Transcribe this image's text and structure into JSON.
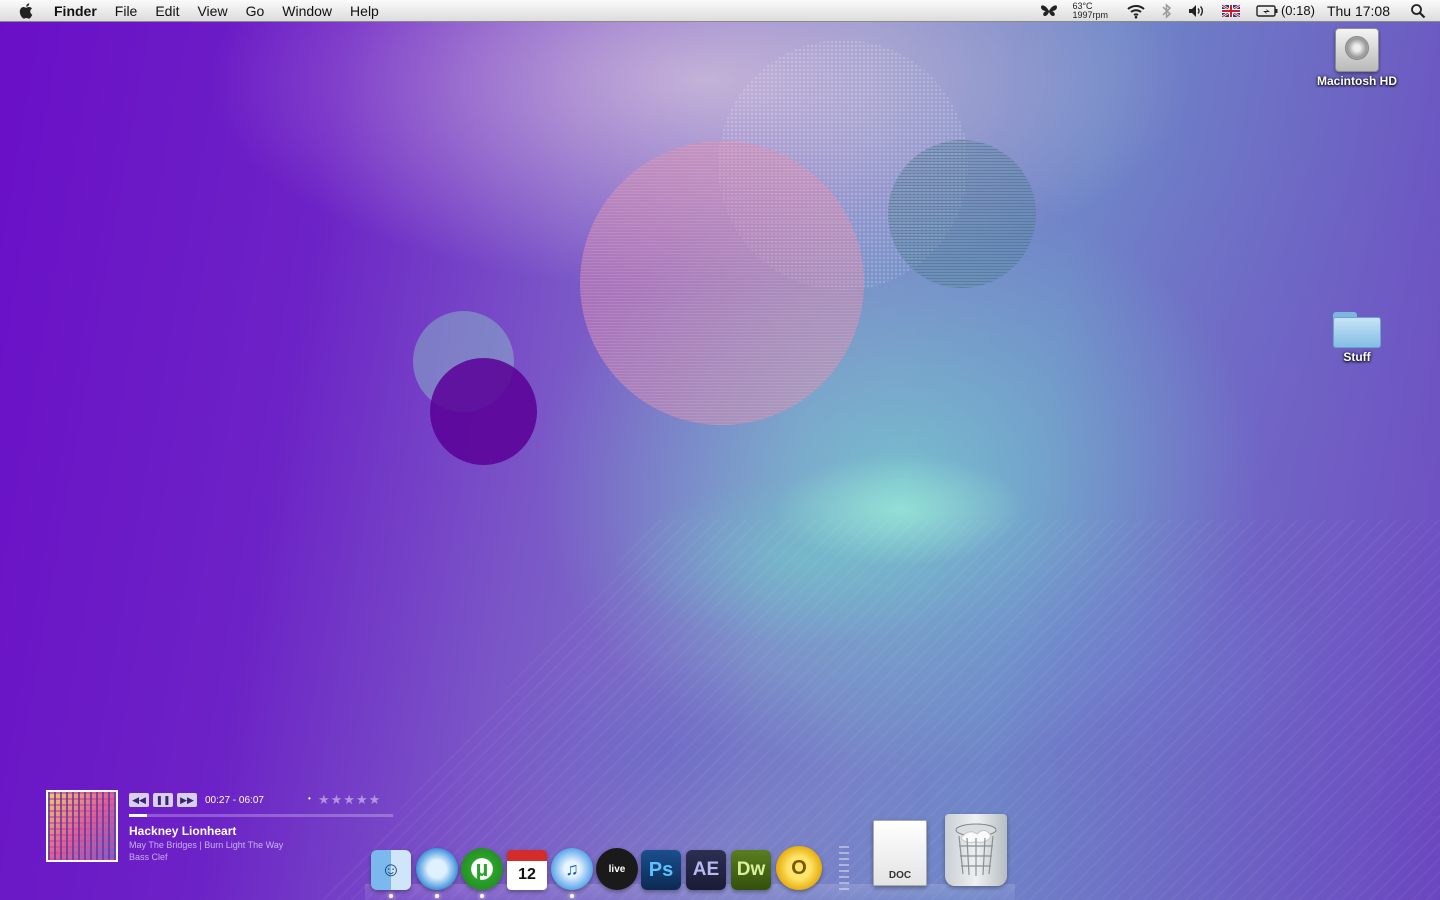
{
  "menubar": {
    "app_name": "Finder",
    "menus": [
      "File",
      "Edit",
      "View",
      "Go",
      "Window",
      "Help"
    ],
    "status": {
      "temperature": "63°C",
      "fan_speed": "1997rpm",
      "battery_time": "(0:18)",
      "clock": "Thu 17:08"
    }
  },
  "desktop": {
    "icons": [
      {
        "label": "Macintosh HD",
        "icon": "hard-drive-icon"
      },
      {
        "label": "Stuff",
        "icon": "folder-icon"
      }
    ]
  },
  "music_widget": {
    "time": "00:27 - 06:07",
    "rating_stars": "★★★★★",
    "progress_fraction": 0.07,
    "track_title": "Hackney Lionheart",
    "track_line2": "May The Bridges | Burn Light The Way",
    "track_line3": "Bass Clef"
  },
  "dock": {
    "apps": [
      {
        "name": "Finder",
        "glyph": "☺"
      },
      {
        "name": "Safari",
        "glyph": ""
      },
      {
        "name": "uTorrent",
        "glyph": "µ"
      },
      {
        "name": "iCal",
        "glyph": "12"
      },
      {
        "name": "iTunes",
        "glyph": "♫"
      },
      {
        "name": "Ableton Live",
        "glyph": "live"
      },
      {
        "name": "Photoshop",
        "glyph": "Ps"
      },
      {
        "name": "After Effects",
        "glyph": "AE"
      },
      {
        "name": "Dreamweaver",
        "glyph": "Dw"
      },
      {
        "name": "Outlook",
        "glyph": "O"
      }
    ],
    "stack_label": "DOC",
    "trash": "Trash"
  }
}
